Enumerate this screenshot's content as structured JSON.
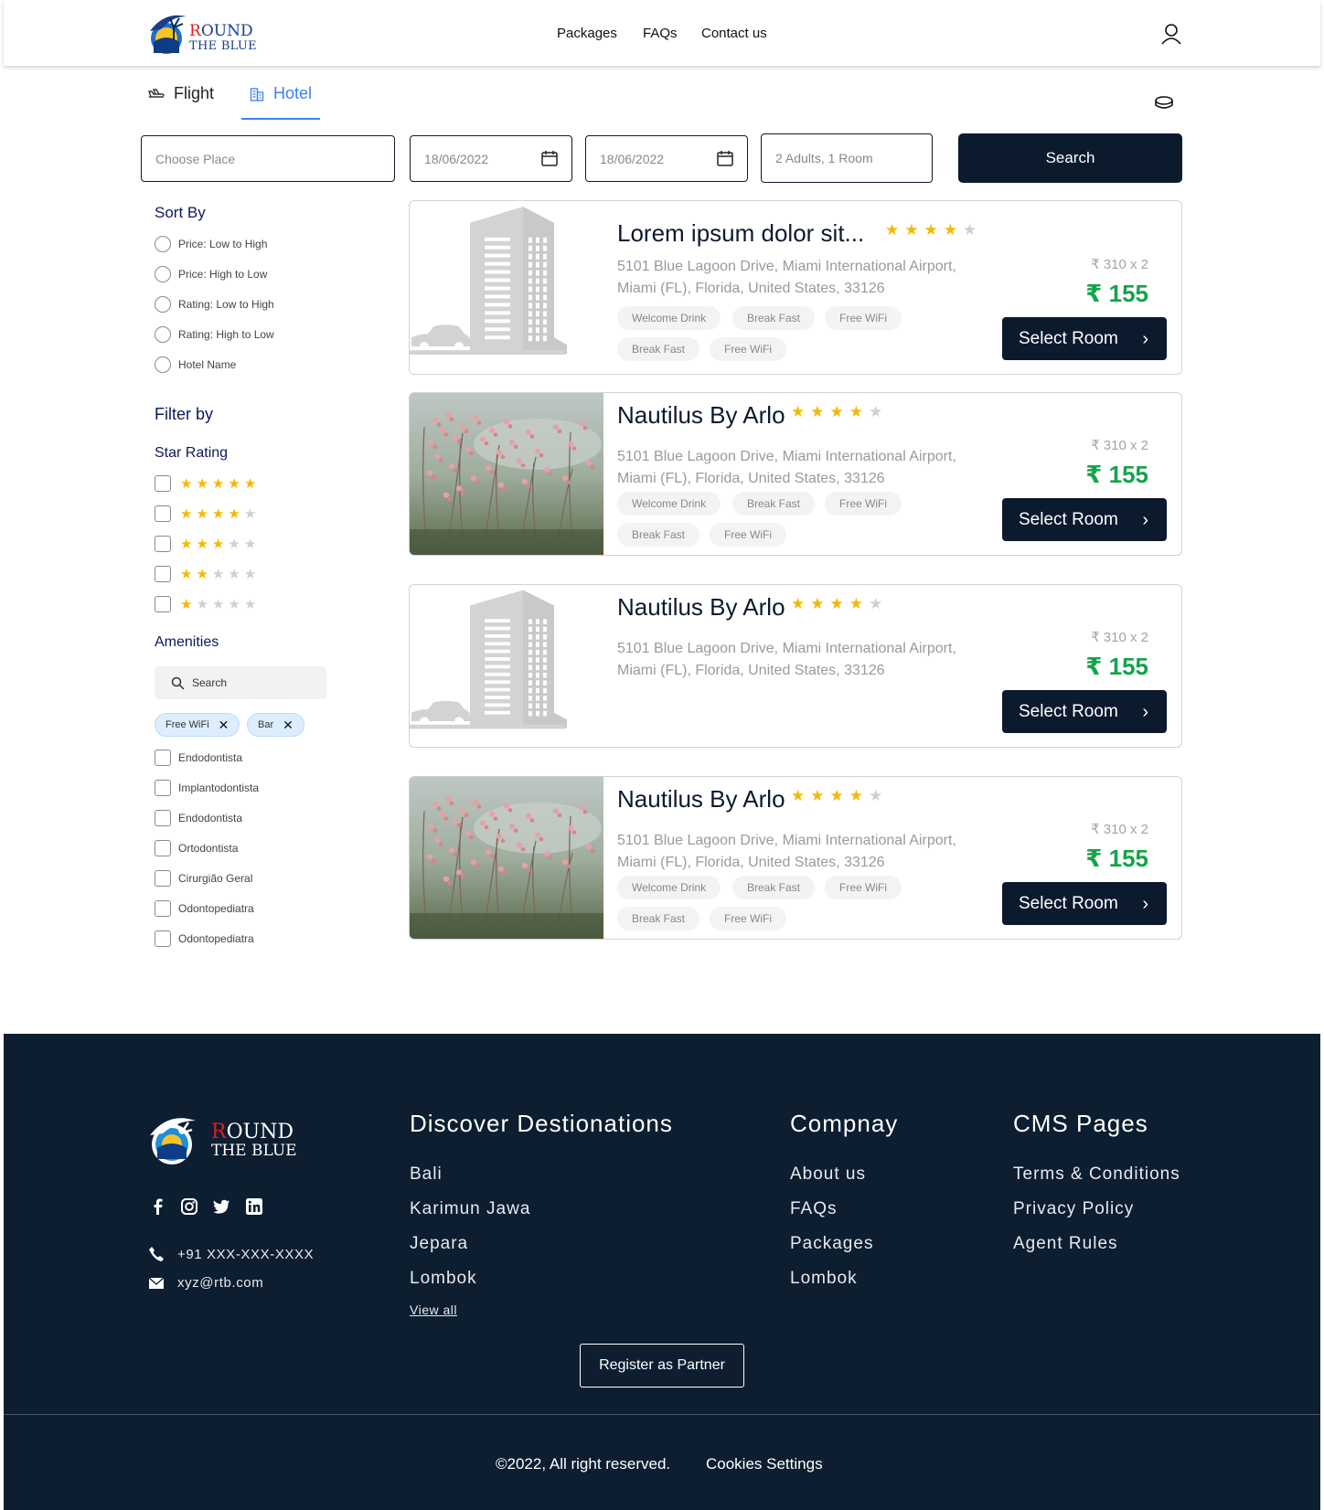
{
  "brand": {
    "line1_red": "R",
    "line1_rest": "OUND",
    "line2": "THE BLUE"
  },
  "nav": {
    "packages": "Packages",
    "faqs": "FAQs",
    "contact": "Contact us"
  },
  "tabs": {
    "flight": "Flight",
    "hotel": "Hotel",
    "active": "Hotel"
  },
  "search": {
    "place_placeholder": "Choose Place",
    "checkin": "18/06/2022",
    "checkout": "18/06/2022",
    "guests": "2 Adults, 1 Room",
    "button": "Search"
  },
  "sidebar": {
    "sort_title": "Sort By",
    "sort_options": [
      "Price: Low to High",
      "Price: High to Low",
      "Rating: Low to High",
      "Rating: High to Low",
      "Hotel Name"
    ],
    "filter_title": "Filter by",
    "star_title": "Star Rating",
    "star_options": [
      5,
      4,
      3,
      2,
      1
    ],
    "amenities_title": "Amenities",
    "amenities_search_placeholder": "Search",
    "chips": [
      "Free WiFi",
      "Bar"
    ],
    "amenity_options": [
      "Endodontista",
      "Implantodontista",
      "Endodontista",
      "Ortodontista",
      "Cirurgião Geral",
      "Odontopediatra",
      "Odontopediatra"
    ]
  },
  "hotels": [
    {
      "name": "Lorem ipsum dolor sit...",
      "rating": 4,
      "address": "5101 Blue Lagoon Drive, Miami International Airport, Miami (FL), Florida, United States, 33126",
      "tags": [
        "Welcome Drink",
        "Break Fast",
        "Free WiFi",
        "Break Fast",
        "Free WiFi"
      ],
      "price_old": "₹ 310 x 2",
      "price": "₹ 155",
      "button": "Select Room",
      "image": "building-placeholder"
    },
    {
      "name": "Nautilus By Arlo",
      "rating": 4,
      "address": "5101 Blue Lagoon Drive, Miami International Airport, Miami (FL), Florida, United States, 33126",
      "tags": [
        "Welcome Drink",
        "Break Fast",
        "Free WiFi",
        "Break Fast",
        "Free WiFi"
      ],
      "price_old": "₹ 310 x 2",
      "price": "₹ 155",
      "button": "Select Room",
      "image": "flower-photo"
    },
    {
      "name": "Nautilus By Arlo",
      "rating": 4,
      "address": "5101 Blue Lagoon Drive, Miami International Airport, Miami (FL), Florida, United States, 33126",
      "tags": [],
      "price_old": "₹ 310 x 2",
      "price": "₹ 155",
      "button": "Select Room",
      "image": "building-placeholder"
    },
    {
      "name": "Nautilus By Arlo",
      "rating": 4,
      "address": "5101 Blue Lagoon Drive, Miami International Airport, Miami (FL), Florida, United States, 33126",
      "tags": [
        "Welcome Drink",
        "Break Fast",
        "Free WiFi",
        "Break Fast",
        "Free WiFi"
      ],
      "price_old": "₹ 310 x 2",
      "price": "₹ 155",
      "button": "Select Room",
      "image": "flower-photo"
    }
  ],
  "footer": {
    "phone": "+91 XXX-XXX-XXXX",
    "email": "xyz@rtb.com",
    "col1_title": "Discover Destionations",
    "col1_links": [
      "Bali",
      "Karimun Jawa",
      "Jepara",
      "Lombok"
    ],
    "view_all": "View all",
    "col2_title": "Compnay",
    "col2_links": [
      "About us",
      "FAQs",
      "Packages",
      "Lombok"
    ],
    "col3_title": "CMS Pages",
    "col3_links": [
      "Terms & Conditions",
      "Privacy Policy",
      "Agent Rules"
    ],
    "partner_button": "Register as Partner",
    "copyright": "©2022, All right reserved.",
    "cookies": "Cookies Settings"
  },
  "colors": {
    "navy": "#0c1a2e",
    "accent": "#3b82f6",
    "price": "#16a34a",
    "star": "#f5b800"
  }
}
